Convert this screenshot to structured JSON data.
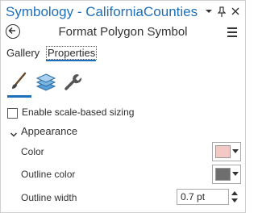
{
  "window": {
    "title": "Symbology - CaliforniaCounties"
  },
  "title_buttons": {
    "dropdown": "▾",
    "pin": "📌",
    "close": "✕"
  },
  "header": {
    "subtitle": "Format Polygon Symbol"
  },
  "tabs": [
    {
      "label": "Gallery"
    },
    {
      "label": "Properties"
    }
  ],
  "icon_tabs": [
    "paintbrush-icon",
    "layers-icon",
    "wrench-icon"
  ],
  "options": {
    "scale_sizing_label": "Enable scale-based sizing",
    "scale_sizing_checked": false
  },
  "appearance": {
    "title": "Appearance",
    "color_label": "Color",
    "color_value": "#f2c9c4",
    "outline_color_label": "Outline color",
    "outline_color_value": "#6e6e6e",
    "outline_width_label": "Outline width",
    "outline_width_value": "0.7 pt"
  },
  "colors": {
    "accent": "#1e6fb9"
  }
}
